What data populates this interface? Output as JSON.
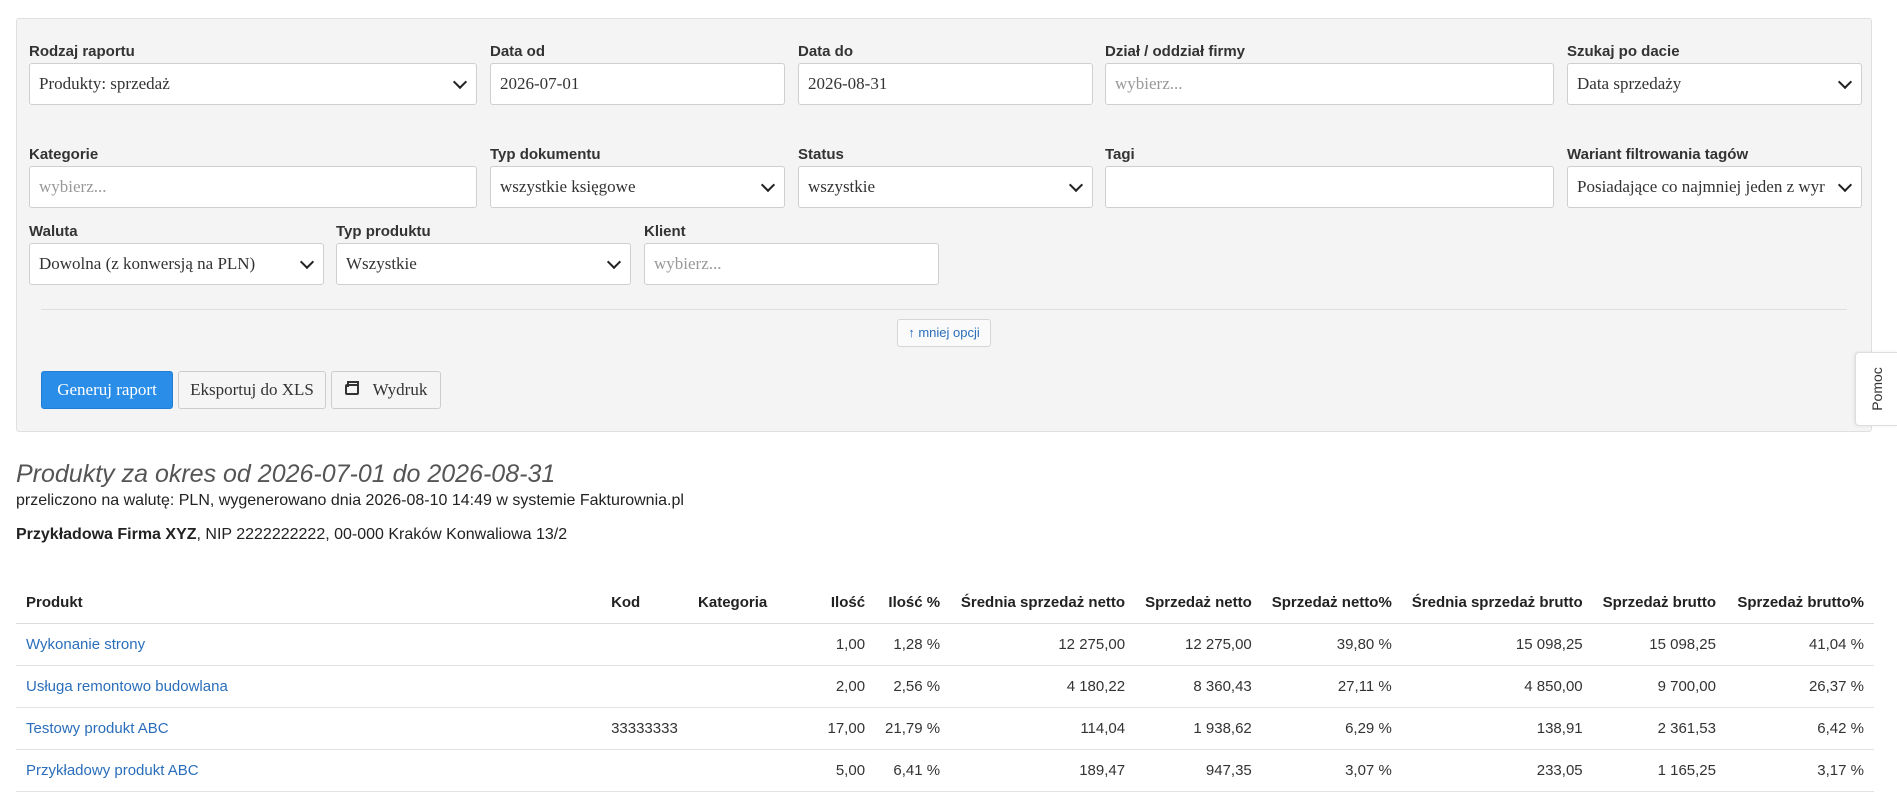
{
  "filters": {
    "report_type": {
      "label": "Rodzaj raportu",
      "value": "Produkty: sprzedaż"
    },
    "date_from": {
      "label": "Data od",
      "value": "2026-07-01"
    },
    "date_to": {
      "label": "Data do",
      "value": "2026-08-31"
    },
    "department": {
      "label": "Dział / oddział firmy",
      "placeholder": "wybierz..."
    },
    "search_by_date": {
      "label": "Szukaj po dacie",
      "value": "Data sprzedaży"
    },
    "categories": {
      "label": "Kategorie",
      "placeholder": "wybierz..."
    },
    "doc_type": {
      "label": "Typ dokumentu",
      "value": "wszystkie księgowe"
    },
    "status": {
      "label": "Status",
      "value": "wszystkie"
    },
    "tags": {
      "label": "Tagi",
      "value": ""
    },
    "tag_variant": {
      "label": "Wariant filtrowania tagów",
      "value": "Posiadające co najmniej jeden z wyr"
    },
    "currency": {
      "label": "Waluta",
      "value": "Dowolna (z konwersją na PLN)"
    },
    "product_type": {
      "label": "Typ produktu",
      "value": "Wszystkie"
    },
    "client": {
      "label": "Klient",
      "placeholder": "wybierz..."
    },
    "less_options": "↑ mniej opcji",
    "generate_button": "Generuj raport",
    "export_button": "Eksportuj do XLS",
    "print_button": "Wydruk"
  },
  "help_tab": "Pomoc",
  "report": {
    "title": "Produkty za okres od 2026-07-01 do 2026-08-31",
    "subtitle": "przeliczono na walutę: PLN, wygenerowano dnia 2026-08-10 14:49 w systemie Fakturownia.pl",
    "company_name": "Przykładowa Firma XYZ",
    "company_rest": ", NIP 2222222222, 00-000 Kraków Konwaliowa 13/2"
  },
  "table": {
    "headers": [
      "Produkt",
      "Kod",
      "Kategoria",
      "Ilość",
      "Ilość %",
      "Średnia sprzedaż netto",
      "Sprzedaż netto",
      "Sprzedaż netto%",
      "Średnia sprzedaż brutto",
      "Sprzedaż brutto",
      "Sprzedaż brutto%"
    ],
    "rows": [
      [
        "Wykonanie strony",
        "",
        "",
        "1,00",
        "1,28 %",
        "12 275,00",
        "12 275,00",
        "39,80 %",
        "15 098,25",
        "15 098,25",
        "41,04 %"
      ],
      [
        "Usługa remontowo budowlana",
        "",
        "",
        "2,00",
        "2,56 %",
        "4 180,22",
        "8 360,43",
        "27,11 %",
        "4 850,00",
        "9 700,00",
        "26,37 %"
      ],
      [
        "Testowy produkt ABC",
        "33333333",
        "",
        "17,00",
        "21,79 %",
        "114,04",
        "1 938,62",
        "6,29 %",
        "138,91",
        "2 361,53",
        "6,42 %"
      ],
      [
        "Przykładowy produkt ABC",
        "",
        "",
        "5,00",
        "6,41 %",
        "189,47",
        "947,35",
        "3,07 %",
        "233,05",
        "1 165,25",
        "3,17 %"
      ]
    ]
  }
}
